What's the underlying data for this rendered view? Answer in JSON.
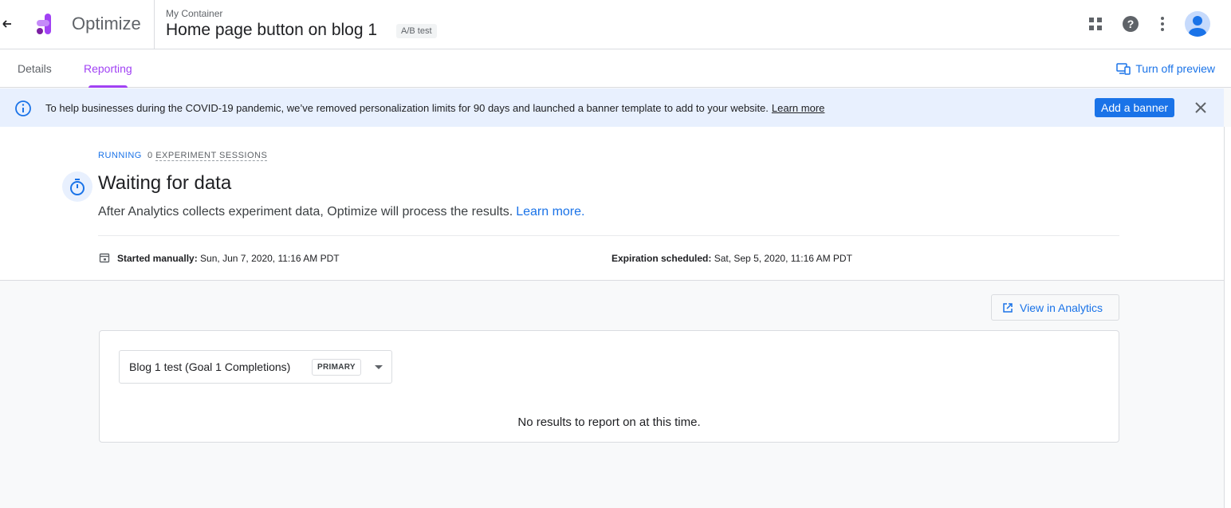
{
  "header": {
    "brand": "Optimize",
    "container": "My Container",
    "title": "Home page button on blog 1",
    "badge": "A/B test"
  },
  "tabs": [
    {
      "label": "Details",
      "active": false
    },
    {
      "label": "Reporting",
      "active": true
    }
  ],
  "turn_off_preview": "Turn off preview",
  "banner": {
    "text": "To help businesses during the COVID-19 pandemic, we’ve removed personalization limits for 90 days and launched a banner template to add to your website.",
    "link": "Learn more",
    "button": "Add a banner"
  },
  "status": {
    "running": "RUNNING",
    "sessions_count": "0",
    "sessions_label": "EXPERIMENT SESSIONS",
    "title": "Waiting for data",
    "description": "After Analytics collects experiment data, Optimize will process the results.",
    "description_link": "Learn more.",
    "started_label": "Started manually:",
    "started_value": "Sun, Jun 7, 2020, 11:16 AM PDT",
    "expiration_label": "Expiration scheduled:",
    "expiration_value": "Sat, Sep 5, 2020, 11:16 AM PDT"
  },
  "view_analytics": "View in Analytics",
  "results": {
    "objective": "Blog 1 test (Goal 1 Completions)",
    "primary_badge": "PRIMARY",
    "empty_message": "No results to report on at this time."
  },
  "colors": {
    "accent": "#a142f4",
    "link": "#1a73e8",
    "banner_bg": "#e8f0fe"
  }
}
